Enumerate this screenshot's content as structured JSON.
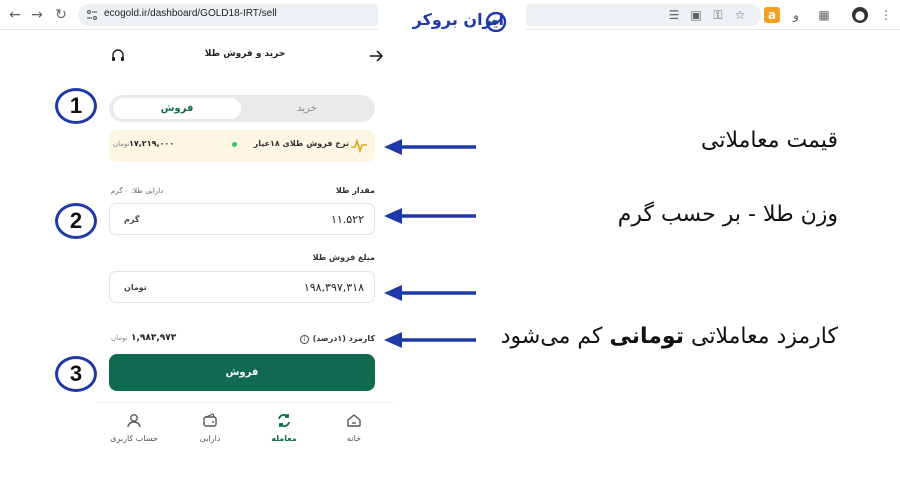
{
  "browser": {
    "url": "ecogold.ir/dashboard/GOLD18-IRT/sell",
    "logo": "ایران بروکر"
  },
  "app": {
    "title": "خرید و فروش طلا",
    "tabs": {
      "buy": "خرید",
      "sell": "فروش"
    },
    "rate": {
      "label": "نرخ فروش طلای ۱۸عیار",
      "value": "۱۷,۲۱۹,۰۰۰",
      "unit": "تومان"
    },
    "amount": {
      "label": "مقدار طلا",
      "holding_label": "دارایی طلا: ۰ گرم",
      "value": "۱۱.۵۲۲",
      "unit": "گرم"
    },
    "price": {
      "label": "مبلغ فروش طلا",
      "value": "۱۹۸,۳۹۷,۳۱۸",
      "unit": "تومان"
    },
    "fee": {
      "label": "کارمزد (۱درصد)",
      "value": "۱,۹۸۳,۹۷۳",
      "unit": "تومان"
    },
    "sell_button": "فروش",
    "nav": [
      {
        "label": "خانه"
      },
      {
        "label": "معامله"
      },
      {
        "label": "دارایی"
      },
      {
        "label": "حساب کاربری"
      }
    ]
  },
  "annotations": {
    "numbers": [
      "1",
      "2",
      "3"
    ],
    "notes": {
      "price": "قیمت معاملاتی",
      "weight": "وزن طلا - بر حسب گرم",
      "fee_prefix": "کارمزد معاملاتی",
      "fee_bold": "تومانی",
      "fee_suffix": "کم می‌شود"
    }
  },
  "colors": {
    "brand": "#106a4f",
    "annotation": "#1f3aa8",
    "rate_bg": "#fdf6e4"
  }
}
